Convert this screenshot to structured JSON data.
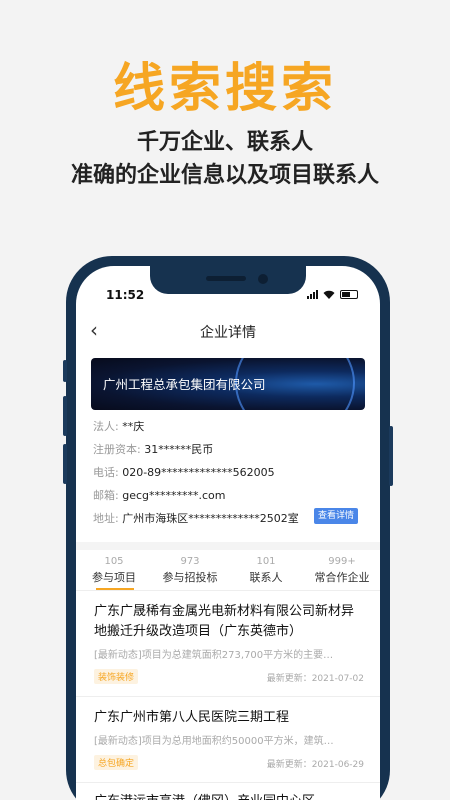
{
  "promo": {
    "title": "线索搜索",
    "subtitle1": "千万企业、联系人",
    "subtitle2": "准确的企业信息以及项目联系人"
  },
  "status_bar": {
    "time": "11:52"
  },
  "nav": {
    "back": "‹",
    "title": "企业详情"
  },
  "company": {
    "name": "广州工程总承包集团有限公司",
    "legal_label": "法人:",
    "legal_value": "**庆",
    "capital_label": "注册资本:",
    "capital_value": "31******民币",
    "phone_label": "电话:",
    "phone_value": "020-89*************562005",
    "email_label": "邮箱:",
    "email_value": "gecg*********.com",
    "address_label": "地址:",
    "address_value": "广州市海珠区*************2502室",
    "detail_button": "查看详情"
  },
  "tabs": [
    {
      "count": "105",
      "label": "参与项目"
    },
    {
      "count": "973",
      "label": "参与招投标"
    },
    {
      "count": "101",
      "label": "联系人"
    },
    {
      "count": "999+",
      "label": "常合作企业"
    }
  ],
  "projects": [
    {
      "title": "广东广晟稀有金属光电新材料有限公司新材异地搬迁升级改造项目（广东英德市）",
      "desc": "[最新动态]项目为总建筑面积273,700平方米的主要…",
      "tag": "装饰装修",
      "date": "最新更新：2021-07-02"
    },
    {
      "title": "广东广州市第八人民医院三期工程",
      "desc": "[最新动态]项目为总用地面积约50000平方米，建筑…",
      "tag": "总包确定",
      "date": "最新更新：2021-06-29"
    },
    {
      "title": "广东港运市高港（佛冈）产业园中心区…"
    }
  ]
}
